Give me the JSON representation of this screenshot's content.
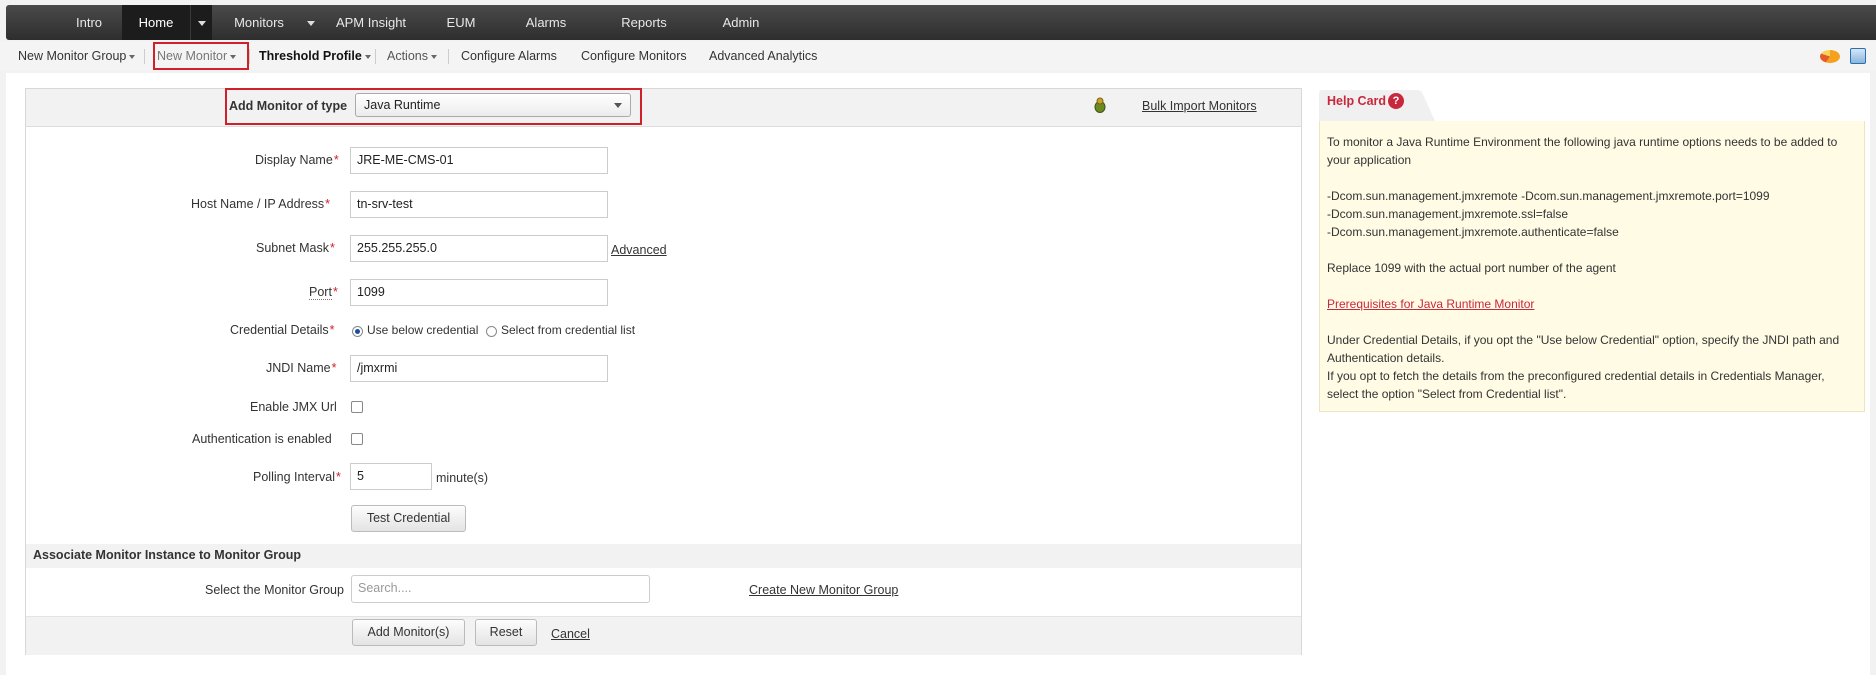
{
  "topnav": {
    "tabs": [
      "Intro",
      "Home",
      "Monitors",
      "APM Insight",
      "EUM",
      "Alarms",
      "Reports",
      "Admin"
    ]
  },
  "subnav": {
    "new_monitor_group": "New Monitor Group",
    "new_monitor": "New Monitor",
    "threshold_profile": "Threshold Profile",
    "actions": "Actions",
    "configure_alarms": "Configure Alarms",
    "configure_monitors": "Configure Monitors",
    "advanced_analytics": "Advanced Analytics"
  },
  "form": {
    "add_monitor_label": "Add Monitor of type",
    "monitor_type": "Java Runtime",
    "bulk_import": "Bulk Import Monitors",
    "display_name_label": "Display Name",
    "display_name_value": "JRE-ME-CMS-01",
    "host_label": "Host Name / IP Address",
    "host_value": "tn-srv-test",
    "subnet_label": "Subnet Mask",
    "subnet_value": "255.255.255.0",
    "advanced_link": "Advanced",
    "port_label": "Port",
    "port_value": "1099",
    "credential_label": "Credential Details",
    "credential_opt1": "Use below credential",
    "credential_opt2": "Select from credential list",
    "jndi_label": "JNDI Name",
    "jndi_value": "/jmxrmi",
    "jmx_url_label": "Enable JMX Url",
    "auth_label": "Authentication is enabled",
    "polling_label": "Polling Interval",
    "polling_value": "5",
    "polling_unit": "minute(s)",
    "test_credential": "Test Credential",
    "associate_title": "Associate Monitor Instance to Monitor Group",
    "select_group_label": "Select the Monitor Group",
    "search_placeholder": "Search....",
    "create_group_link": "Create New Monitor Group",
    "add_button": "Add Monitor(s)",
    "reset_button": "Reset",
    "cancel_link": "Cancel",
    "required_mark": "*"
  },
  "help": {
    "title": "Help Card",
    "q_mark": "?",
    "line1": "To monitor a Java Runtime Environment the following java runtime options needs to be added to",
    "line2": "your application",
    "opt1": "-Dcom.sun.management.jmxremote -Dcom.sun.management.jmxremote.port=1099",
    "opt2": "-Dcom.sun.management.jmxremote.ssl=false",
    "opt3": "-Dcom.sun.management.jmxremote.authenticate=false",
    "replace": "Replace 1099 with the actual port number of the agent",
    "prereq_link": "Prerequisites for Java Runtime Monitor",
    "cred1": "Under Credential Details, if you opt the \"Use below Credential\" option, specify the JNDI path and",
    "cred2": "Authentication details.",
    "cred3": "If you opt to fetch the details from the preconfigured credential details in Credentials Manager,",
    "cred4": "select the option \"Select from Credential list\"."
  }
}
